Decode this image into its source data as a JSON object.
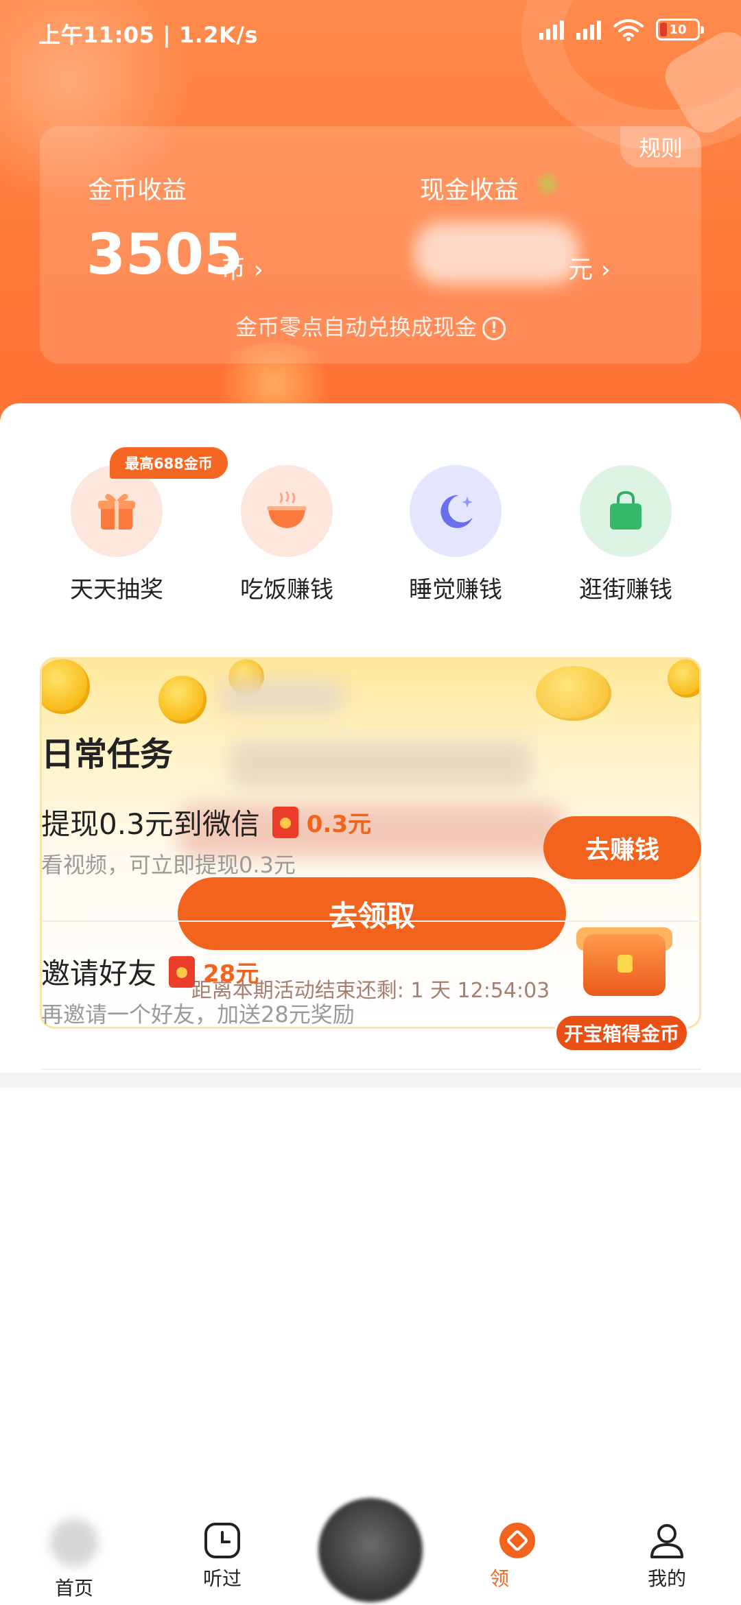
{
  "status_bar": {
    "time_speed": "上午11:05 | 1.2K/s",
    "battery": "10"
  },
  "earnings": {
    "rules": "规则",
    "coin_label": "金币收益",
    "coin_value": "3505",
    "coin_unit": "币 ›",
    "cash_label": "现金收益",
    "cash_unit": "元 ›",
    "convert_note": "金币零点自动兑换成现金",
    "info_glyph": "!"
  },
  "features": {
    "badge": "最高688金币",
    "items": [
      {
        "label": "天天抽奖",
        "icon": "gift-icon"
      },
      {
        "label": "吃饭赚钱",
        "icon": "bowl-icon"
      },
      {
        "label": "睡觉赚钱",
        "icon": "moon-icon"
      },
      {
        "label": "逛街赚钱",
        "icon": "shopping-bag-icon"
      }
    ]
  },
  "activity": {
    "claim_label": "去领取",
    "countdown": "距离本期活动结束还剩: 1 天 12:54:03"
  },
  "tasks": {
    "title": "日常任务",
    "items": [
      {
        "title": "提现0.3元到微信",
        "reward": "0.3元",
        "desc": "看视频，可立即提现0.3元",
        "action": "去赚钱"
      },
      {
        "title": "邀请好友",
        "reward": "28元",
        "desc": "再邀请一个好友，加送28元奖励",
        "action": "开宝箱得金币"
      }
    ]
  },
  "nav": {
    "home": "首页",
    "history": "听过",
    "earn": "领",
    "mine": "我的"
  },
  "colors": {
    "brand_orange": "#f2641d",
    "header_orange": "#ff7a3a"
  }
}
